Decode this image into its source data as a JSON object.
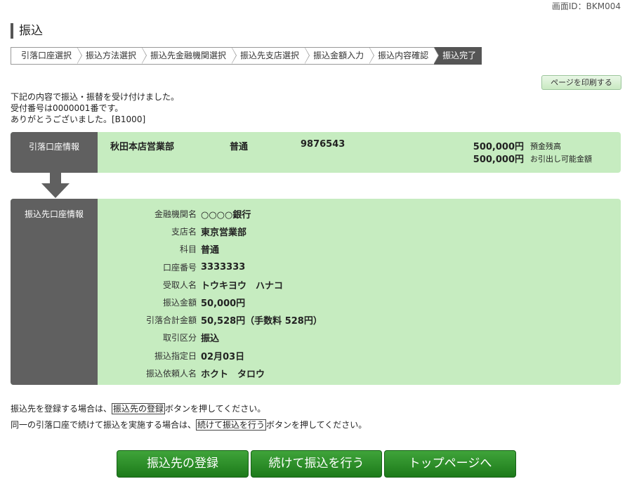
{
  "screen_id": "画面ID：BKM004",
  "title": "振込",
  "steps": [
    "引落口座選択",
    "振込方法選択",
    "振込先金融機関選択",
    "振込先支店選択",
    "振込金額入力",
    "振込内容確認",
    "振込完了"
  ],
  "print_button": "ページを印刷する",
  "message": [
    "下記の内容で振込・振替を受け付けました。",
    "受付番号は0000001番です。",
    "ありがとうございました。[B1000]"
  ],
  "source": {
    "heading": "引落口座情報",
    "branch": "秋田本店営業部",
    "type": "普通",
    "account": "9876543",
    "balance": "500,000円",
    "balance_label": "預金残高",
    "available": "500,000円",
    "available_label": "お引出し可能金額"
  },
  "dest": {
    "heading": "振込先口座情報",
    "rows": [
      {
        "k": "金融機関名",
        "v": "○○○○銀行"
      },
      {
        "k": "支店名",
        "v": "東京営業部"
      },
      {
        "k": "科目",
        "v": "普通"
      },
      {
        "k": "口座番号",
        "v": "3333333"
      },
      {
        "k": "受取人名",
        "v": "トウキヨウ　ハナコ"
      },
      {
        "k": "振込金額",
        "v": "50,000円"
      },
      {
        "k": "引落合計金額",
        "v": "50,528円（手数料 528円）"
      },
      {
        "k": "取引区分",
        "v": "振込"
      },
      {
        "k": "振込指定日",
        "v": "02月03日"
      },
      {
        "k": "振込依頼人名",
        "v": "ホクト　タロウ"
      }
    ]
  },
  "note1": {
    "pre": "振込先を登録する場合は、",
    "boxed": "振込先の登録",
    "post": "ボタンを押してください。"
  },
  "note2": {
    "pre": "同一の引落口座で続けて振込を実施する場合は、",
    "boxed": "続けて振込を行う",
    "post": "ボタンを押してください。"
  },
  "buttons": {
    "register": "振込先の登録",
    "continue": "続けて振込を行う",
    "top": "トップページへ"
  }
}
